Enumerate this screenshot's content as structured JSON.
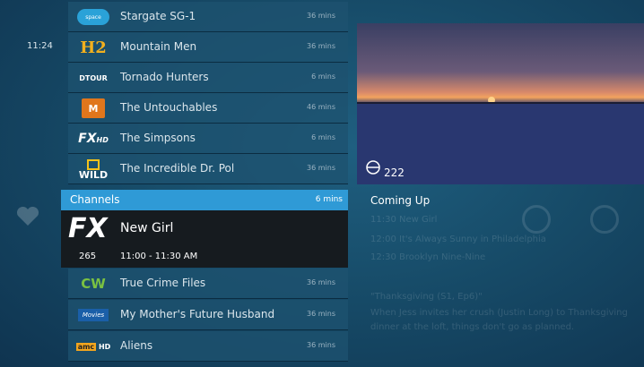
{
  "clock": "11:24",
  "guide_rows": [
    {
      "logo": "space",
      "title": "Stargate SG-1",
      "duration": "36 mins"
    },
    {
      "logo": "H2",
      "title": "Mountain Men",
      "duration": "36 mins"
    },
    {
      "logo": "DTOUR",
      "title": "Tornado Hunters",
      "duration": "6 mins"
    },
    {
      "logo": "M1",
      "title": "The Untouchables",
      "duration": "46 mins"
    },
    {
      "logo": "FXHD",
      "title": "The Simpsons",
      "duration": "6 mins"
    },
    {
      "logo": "WILD",
      "title": "The Incredible Dr. Pol",
      "duration": "36 mins"
    }
  ],
  "channels_bar": {
    "label": "Channels",
    "duration": "6 mins"
  },
  "selected": {
    "logo": "FX",
    "title": "New Girl",
    "channel_number": "265",
    "time_range": "11:00 - 11:30 AM"
  },
  "guide_rows_below": [
    {
      "logo": "CW HD",
      "title": "True Crime Files",
      "duration": "36 mins"
    },
    {
      "logo": "Movies",
      "title": "My Mother's Future Husband",
      "duration": "36 mins"
    },
    {
      "logo": "amc HD",
      "title": "Aliens",
      "duration": "36 mins"
    }
  ],
  "preview": {
    "channel_label": "222"
  },
  "coming_up": {
    "title": "Coming Up",
    "lines": [
      "11:30 New Girl",
      "12:00 It's Always Sunny in Philadelphia",
      "12:30 Brooklyn Nine-Nine",
      "\"Thanksgiving (S1, Ep6)\"",
      "When Jess invites her crush (Justin Long) to Thanksgiving",
      "dinner at the loft, things don't go as planned."
    ]
  }
}
